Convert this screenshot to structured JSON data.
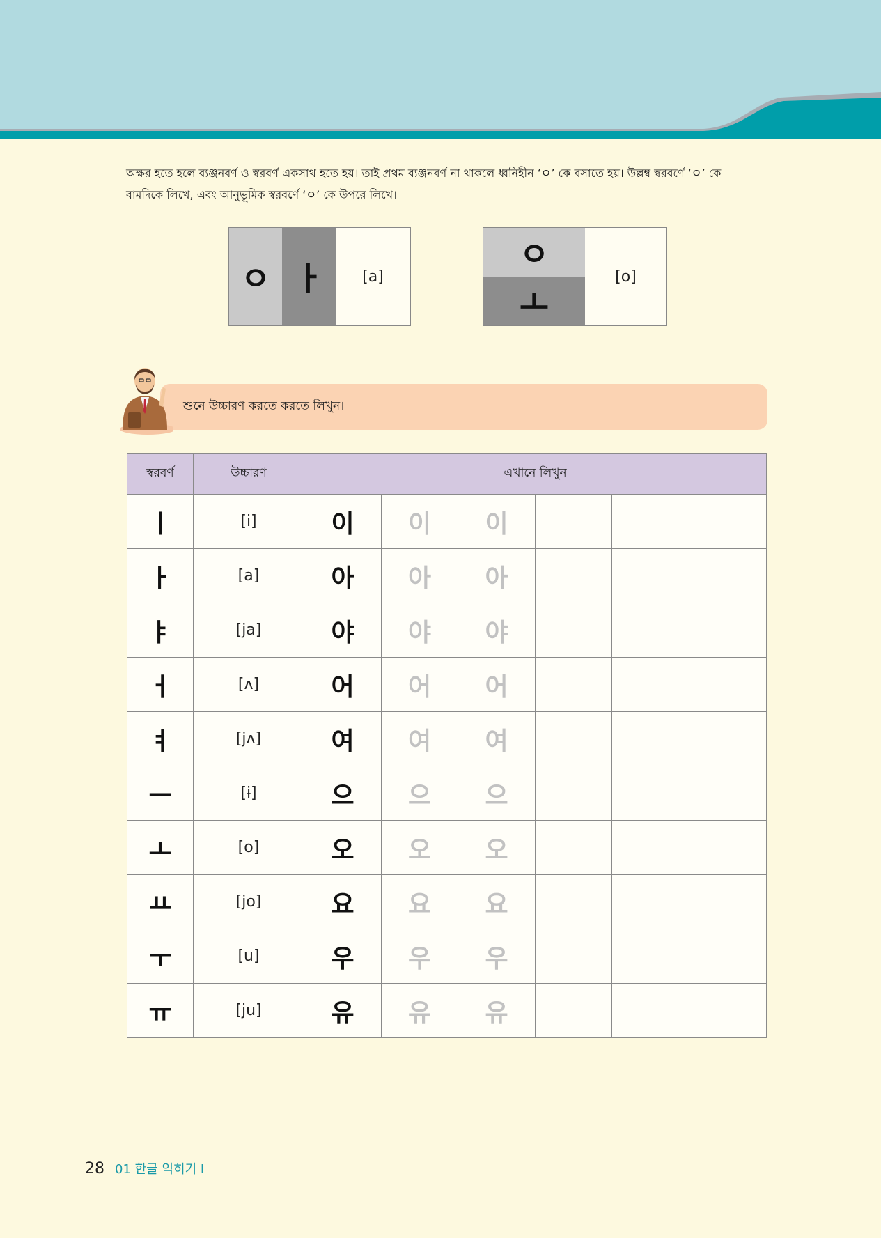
{
  "intro": {
    "line1": "অক্ষর হতে হলে ব্যঞ্জনবর্ণ ও স্বরবর্ণ একসাথ হতে হয়। তাই প্রথম ব্যঞ্জনবর্ণ না থাকলে ধ্বনিহীন ‘ㅇ’ কে বসাতে হয়। উল্লম্ব স্বরবর্ণে ‘ㅇ’ কে",
    "line2": "বামদিকে লিখে, এবং আনুভূমিক স্বরবর্ণে ‘ㅇ’ কে উপরে লিখে।"
  },
  "demo": {
    "vertical": {
      "consonant": "ㅇ",
      "vowel": "ㅏ",
      "ipa": "[a]"
    },
    "horizontal": {
      "consonant": "ㅇ",
      "vowel": "ㅗ",
      "ipa": "[o]"
    }
  },
  "banner": {
    "text": "শুনে উচ্চারণ করতে করতে লিখুন।"
  },
  "table": {
    "headers": {
      "vowel": "স্বরবর্ণ",
      "pronunciation": "উচ্চারণ",
      "write": "এখানে লিখুন"
    },
    "rows": [
      {
        "vowel": "ㅣ",
        "ipa": "[i]",
        "syllable": "이"
      },
      {
        "vowel": "ㅏ",
        "ipa": "[a]",
        "syllable": "아"
      },
      {
        "vowel": "ㅑ",
        "ipa": "[ja]",
        "syllable": "야"
      },
      {
        "vowel": "ㅓ",
        "ipa": "[ʌ]",
        "syllable": "어"
      },
      {
        "vowel": "ㅕ",
        "ipa": "[jʌ]",
        "syllable": "여"
      },
      {
        "vowel": "ㅡ",
        "ipa": "[ɨ]",
        "syllable": "으"
      },
      {
        "vowel": "ㅗ",
        "ipa": "[o]",
        "syllable": "오"
      },
      {
        "vowel": "ㅛ",
        "ipa": "[jo]",
        "syllable": "요"
      },
      {
        "vowel": "ㅜ",
        "ipa": "[u]",
        "syllable": "우"
      },
      {
        "vowel": "ㅠ",
        "ipa": "[ju]",
        "syllable": "유"
      }
    ]
  },
  "footer": {
    "page_number": "28",
    "chapter": "01 한글 익히기 Ⅰ"
  },
  "colors": {
    "header_light": "#b1dae0",
    "header_dark": "#009eaa",
    "page_bg": "#fdf9df",
    "banner": "#fbd3b3",
    "table_header": "#d4c8e0",
    "trace_text": "#c2c2c2"
  }
}
